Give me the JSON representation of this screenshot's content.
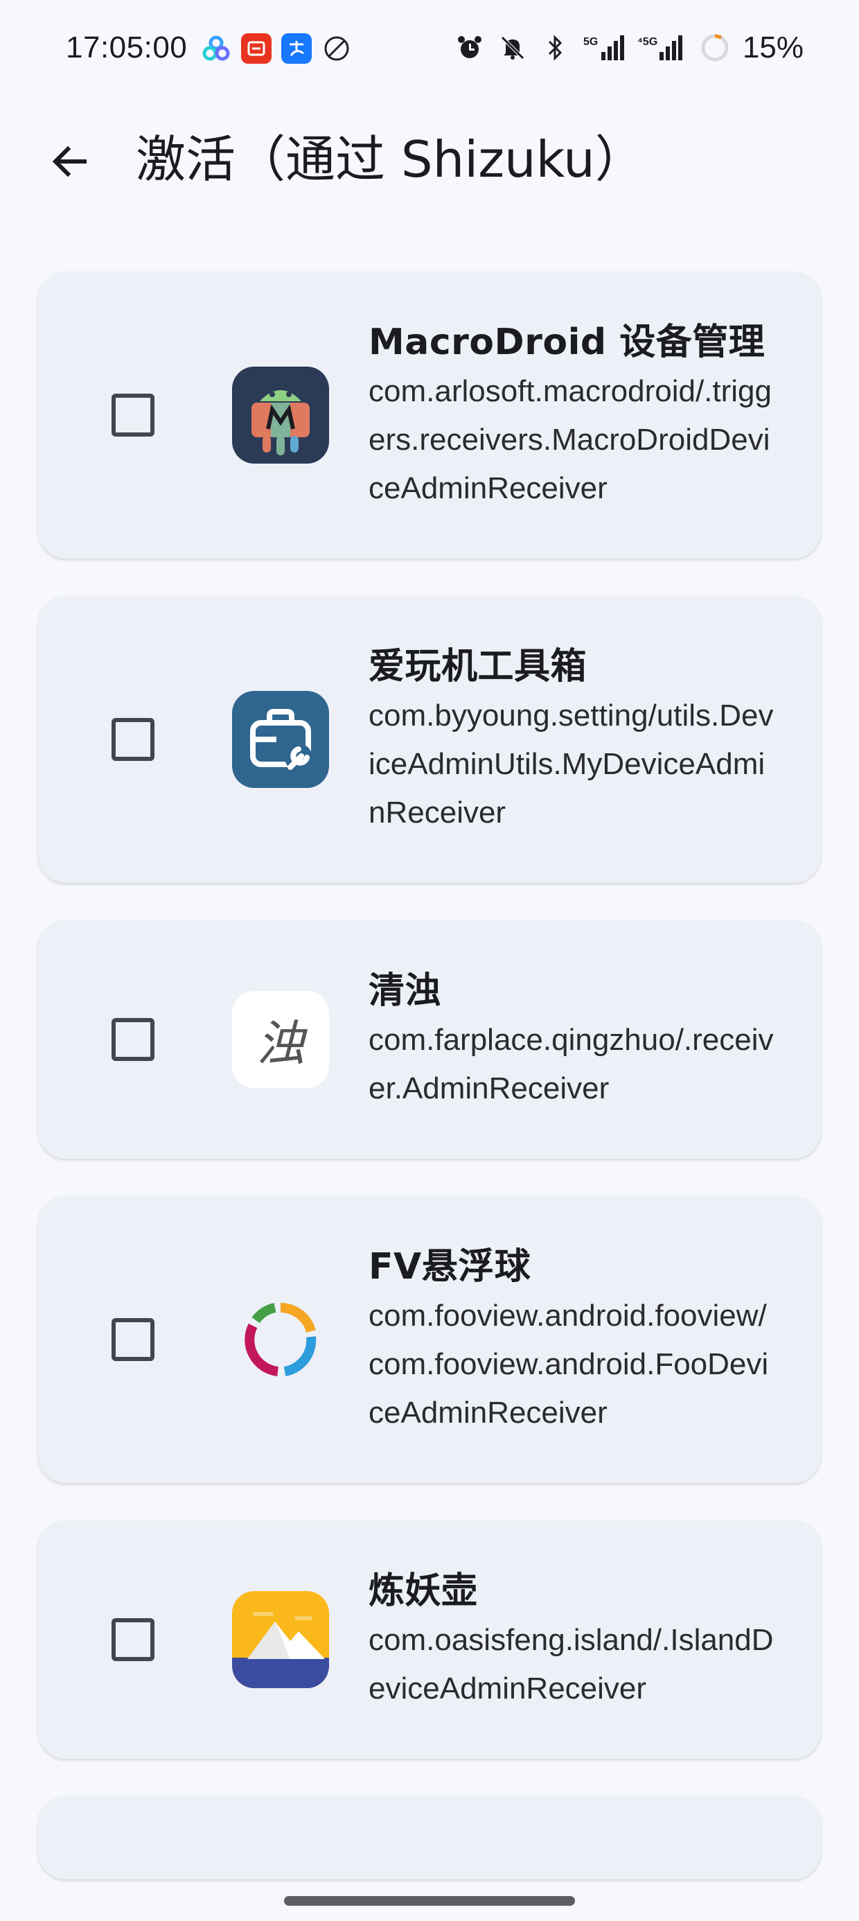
{
  "status_bar": {
    "time": "17:05:00",
    "battery": "15%",
    "net1": "5G",
    "net2": "5G"
  },
  "app_bar": {
    "title": "激活（通过 Shizuku）"
  },
  "items": [
    {
      "name": "MacroDroid 设备管理",
      "component": "com.arlosoft.macrodroid/.triggers.receivers.MacroDroidDeviceAdminReceiver",
      "icon": "macrodroid-icon",
      "checked": false
    },
    {
      "name": "爱玩机工具箱",
      "component": "com.byyoung.setting/utils.DeviceAdminUtils.MyDeviceAdminReceiver",
      "icon": "toolbox-icon",
      "checked": false
    },
    {
      "name": "清浊",
      "component": "com.farplace.qingzhuo/.receiver.AdminReceiver",
      "icon": "qingzhuo-icon",
      "icon_text": "浊",
      "checked": false
    },
    {
      "name": "FV悬浮球",
      "component": "com.fooview.android.fooview/com.fooview.android.FooDeviceAdminReceiver",
      "icon": "fv-ring-icon",
      "checked": false
    },
    {
      "name": "炼妖壶",
      "component": "com.oasisfeng.island/.IslandDeviceAdminReceiver",
      "icon": "island-icon",
      "checked": false
    }
  ],
  "colors": {
    "background": "#f7f8fd",
    "card": "#eef0f8"
  }
}
